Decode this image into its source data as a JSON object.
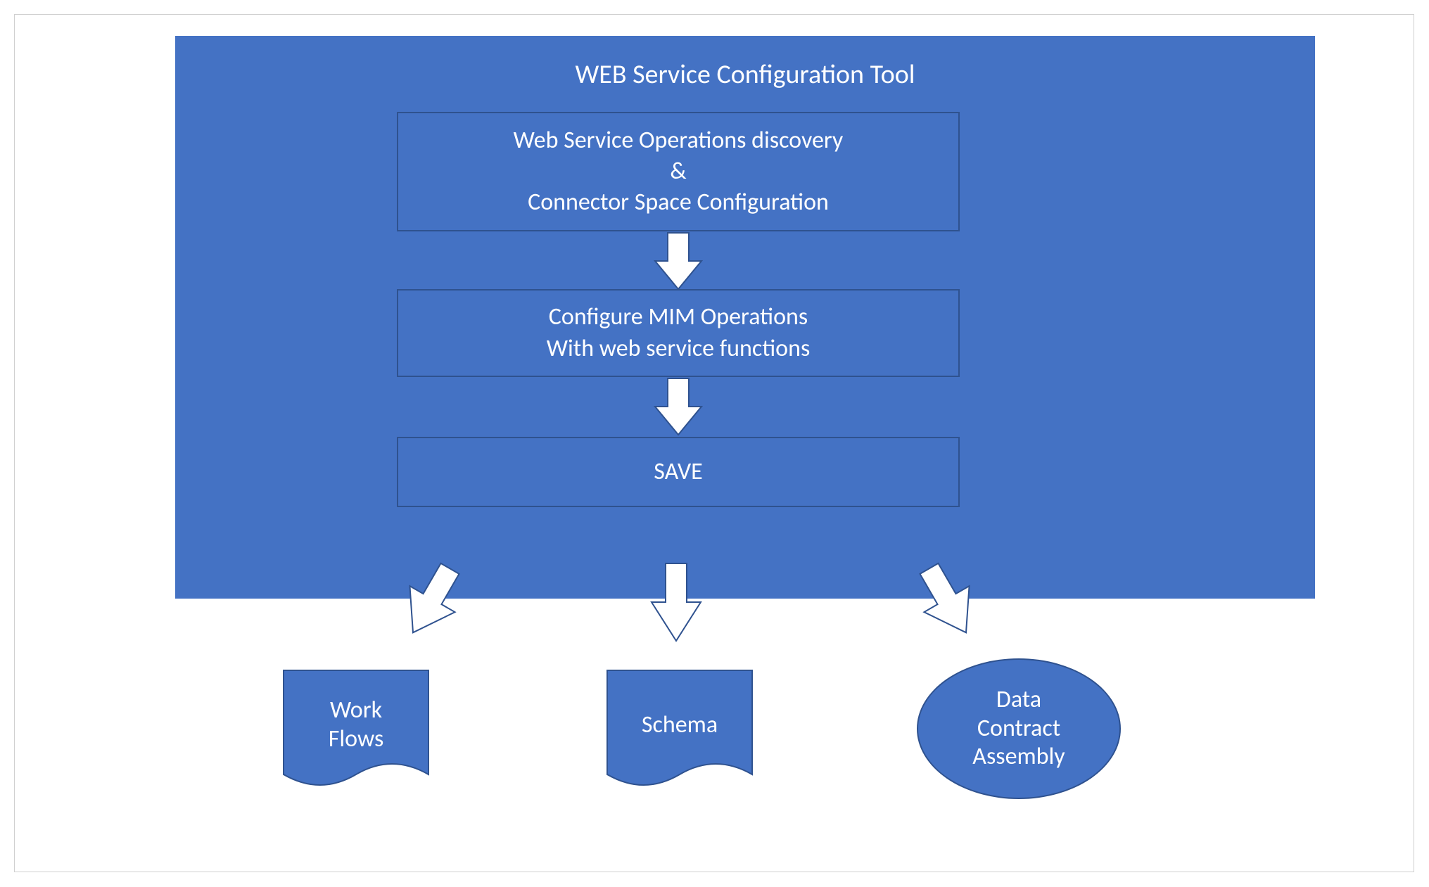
{
  "title": "WEB Service Configuration Tool",
  "box1": {
    "line1": "Web Service Operations discovery",
    "line2": "&",
    "line3": "Connector Space Configuration"
  },
  "box2": {
    "line1": "Configure MIM Operations",
    "line2": "With web service functions"
  },
  "box3": {
    "line1": "SAVE"
  },
  "outputs": {
    "workflows": {
      "line1": "Work",
      "line2": "Flows"
    },
    "schema": {
      "line1": "Schema"
    },
    "datacontract": {
      "line1": "Data",
      "line2": "Contract",
      "line3": "Assembly"
    }
  },
  "colors": {
    "primary": "#4472C4",
    "border": "#2F528F",
    "arrow": "#ffffff"
  }
}
